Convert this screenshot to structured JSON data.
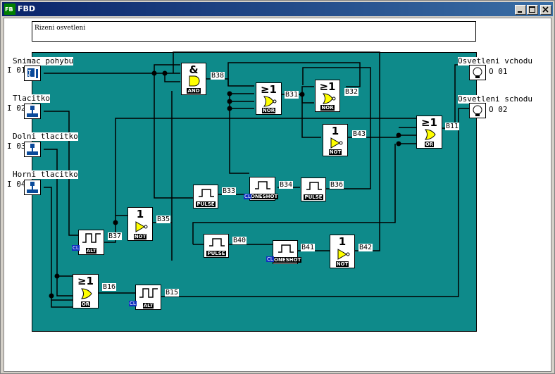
{
  "window": {
    "title": "FBD"
  },
  "comment": "Rizeni osvetleni",
  "inputs": [
    {
      "id": "I01",
      "label": "Snimac pohybu",
      "num": "I 01",
      "icon": "motion-sensor-icon"
    },
    {
      "id": "I02",
      "label": "Tlacitko",
      "num": "I 02",
      "icon": "push-button-icon"
    },
    {
      "id": "I03",
      "label": "Dolni tlacitko",
      "num": "I 03",
      "icon": "push-button-icon"
    },
    {
      "id": "I04",
      "label": "Horni tlacitko",
      "num": "I 04",
      "icon": "push-button-icon"
    }
  ],
  "outputs": [
    {
      "id": "Q01",
      "label": "Osvetleni vchodu",
      "num": "O 01",
      "icon": "lamp-icon"
    },
    {
      "id": "Q02",
      "label": "Osvetleni schodu",
      "num": "O 02",
      "icon": "lamp-icon"
    }
  ],
  "blocks": {
    "B38": {
      "name": "B38",
      "type": "AND",
      "symbol": "&"
    },
    "B31": {
      "name": "B31",
      "type": "NOR",
      "symbol": "≥1"
    },
    "B32": {
      "name": "B32",
      "type": "NOR",
      "symbol": "≥1"
    },
    "B43": {
      "name": "B43",
      "type": "NOT",
      "symbol": "1"
    },
    "B11": {
      "name": "B11",
      "type": "OR",
      "symbol": "≥1"
    },
    "B33": {
      "name": "B33",
      "type": "PULSE"
    },
    "B34": {
      "name": "B34",
      "type": "ONESHOT"
    },
    "B36": {
      "name": "B36",
      "type": "PULSE"
    },
    "B37": {
      "name": "B37",
      "type": "ALT"
    },
    "B35": {
      "name": "B35",
      "type": "NOT",
      "symbol": "1"
    },
    "B40": {
      "name": "B40",
      "type": "PULSE"
    },
    "B41": {
      "name": "B41",
      "type": "ONESHOT"
    },
    "B42": {
      "name": "B42",
      "type": "NOT",
      "symbol": "1"
    },
    "B16": {
      "name": "B16",
      "type": "OR",
      "symbol": "≥1"
    },
    "B15": {
      "name": "B15",
      "type": "ALT"
    }
  },
  "cl_tag": "CL",
  "colors": {
    "panel": "#0e8a8a",
    "gate_fill": "#ffff00",
    "titlebar": "#0a246a"
  }
}
